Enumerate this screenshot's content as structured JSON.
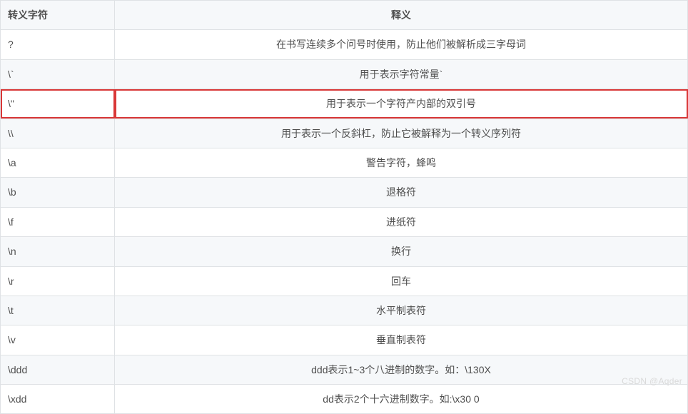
{
  "table": {
    "headers": {
      "escape": "转义字符",
      "meaning": "释义"
    },
    "rows": [
      {
        "escape": "?",
        "meaning": "在书写连续多个问号时使用，防止他们被解析成三字母词",
        "highlight": false
      },
      {
        "escape": "\\`",
        "meaning": "用于表示字符常量`",
        "highlight": false
      },
      {
        "escape": "\\\"",
        "meaning": "用于表示一个字符产内部的双引号",
        "highlight": true
      },
      {
        "escape": "\\\\",
        "meaning": "用于表示一个反斜杠，防止它被解释为一个转义序列符",
        "highlight": false
      },
      {
        "escape": "\\a",
        "meaning": "警告字符，蜂鸣",
        "highlight": false
      },
      {
        "escape": "\\b",
        "meaning": "退格符",
        "highlight": false
      },
      {
        "escape": "\\f",
        "meaning": "进纸符",
        "highlight": false
      },
      {
        "escape": "\\n",
        "meaning": "换行",
        "highlight": false
      },
      {
        "escape": "\\r",
        "meaning": "回车",
        "highlight": false
      },
      {
        "escape": "\\t",
        "meaning": "水平制表符",
        "highlight": false
      },
      {
        "escape": "\\v",
        "meaning": "垂直制表符",
        "highlight": false
      },
      {
        "escape": "\\ddd",
        "meaning": "ddd表示1~3个八进制的数字。如：\\130X",
        "highlight": false
      },
      {
        "escape": "\\xdd",
        "meaning": "dd表示2个十六进制数字。如:\\x30 0",
        "highlight": false
      }
    ]
  },
  "watermark": "CSDN @Aqder"
}
